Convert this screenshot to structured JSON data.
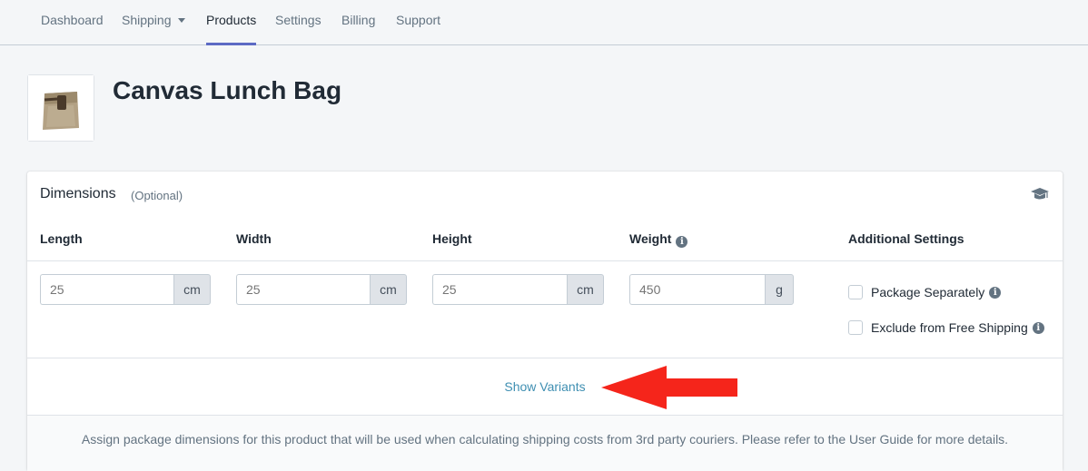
{
  "nav": {
    "items": [
      {
        "label": "Dashboard"
      },
      {
        "label": "Shipping"
      },
      {
        "label": "Products"
      },
      {
        "label": "Settings"
      },
      {
        "label": "Billing"
      },
      {
        "label": "Support"
      }
    ],
    "active": "Products"
  },
  "product": {
    "title": "Canvas Lunch Bag",
    "thumbnail_icon": "canvas-bag-image"
  },
  "dimensions": {
    "title": "Dimensions",
    "subtitle": "(Optional)",
    "help_icon": "graduation-cap-icon",
    "columns": {
      "length": "Length",
      "width": "Width",
      "height": "Height",
      "weight": "Weight",
      "additional": "Additional Settings"
    },
    "fields": {
      "length": {
        "placeholder": "25",
        "unit": "cm"
      },
      "width": {
        "placeholder": "25",
        "unit": "cm"
      },
      "height": {
        "placeholder": "25",
        "unit": "cm"
      },
      "weight": {
        "placeholder": "450",
        "unit": "g"
      }
    },
    "settings": {
      "package_separately": "Package Separately",
      "exclude_free_shipping": "Exclude from Free Shipping"
    },
    "show_variants": "Show Variants",
    "footer": "Assign package dimensions for this product that will be used when calculating shipping costs from 3rd party couriers. Please refer to the User Guide for more details."
  },
  "colors": {
    "accent": "#5c6ac4",
    "link": "#3f8fb2",
    "arrow": "#f5251b"
  }
}
